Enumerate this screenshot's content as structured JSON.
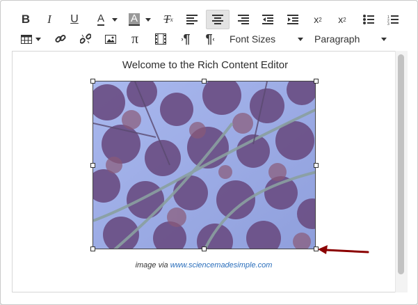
{
  "toolbar": {
    "bold": "B",
    "italic": "I",
    "underline": "U",
    "font_color": "A",
    "background_color": "A",
    "clear_format": "T",
    "superscript": "x",
    "superscript_mark": "2",
    "subscript": "x",
    "subscript_mark": "2",
    "font_sizes_label": "Font Sizes",
    "paragraph_label": "Paragraph",
    "pilcrow": "¶",
    "rtl_pilcrow": "¶",
    "pi": "π"
  },
  "editor": {
    "heading": "Welcome to the Rich Content Editor",
    "caption_prefix": "image via ",
    "caption_link": "www.sciencemadesimple.com"
  },
  "colors": {
    "image_sky": "#9fb0e8",
    "image_leaves": "#6b4f85",
    "arrow": "#8b0000",
    "link": "#2a6ebb"
  },
  "icons": {
    "table": "table-icon",
    "link": "link-icon",
    "unlink": "unlink-icon",
    "image": "image-icon",
    "media": "film-icon",
    "alignment": "align-center-icon"
  }
}
